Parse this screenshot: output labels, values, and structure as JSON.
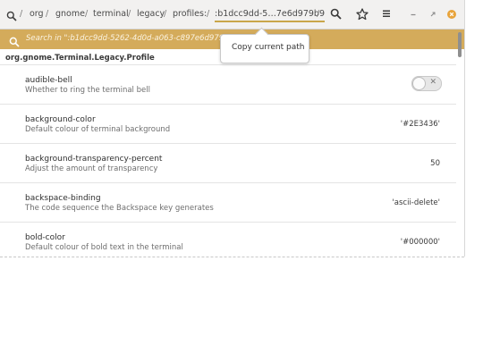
{
  "breadcrumb": {
    "items": [
      "org",
      "gnome",
      "terminal",
      "legacy",
      "profiles:",
      ":b1dcc9dd-5…7e6d979b9"
    ],
    "separator": "/"
  },
  "search": {
    "query": "Search in \":b1dcc9dd-5262-4d0d-a063-c897e6d979b9"
  },
  "tooltip": {
    "text": "Copy current path"
  },
  "schema": {
    "title": "org.gnome.Terminal.Legacy.Profile"
  },
  "keys": [
    {
      "name": "audible-bell",
      "description": "Whether to ring the terminal bell",
      "value": "",
      "type": "toggle",
      "state": false
    },
    {
      "name": "background-color",
      "description": "Default colour of terminal background",
      "value": "'#2E3436'"
    },
    {
      "name": "background-transparency-percent",
      "description": "Adjust the amount of transparency",
      "value": "50"
    },
    {
      "name": "backspace-binding",
      "description": "The code sequence the Backspace key generates",
      "value": "'ascii-delete'"
    },
    {
      "name": "bold-color",
      "description": "Default colour of bold text in the terminal",
      "value": "'#000000'"
    }
  ],
  "colors": {
    "accent": "#d4ab5b",
    "close": "#e8a33a"
  },
  "icons": [
    "search-icon",
    "star-icon",
    "hamburger-menu-icon",
    "minimize-icon",
    "restore-icon",
    "close-icon"
  ]
}
